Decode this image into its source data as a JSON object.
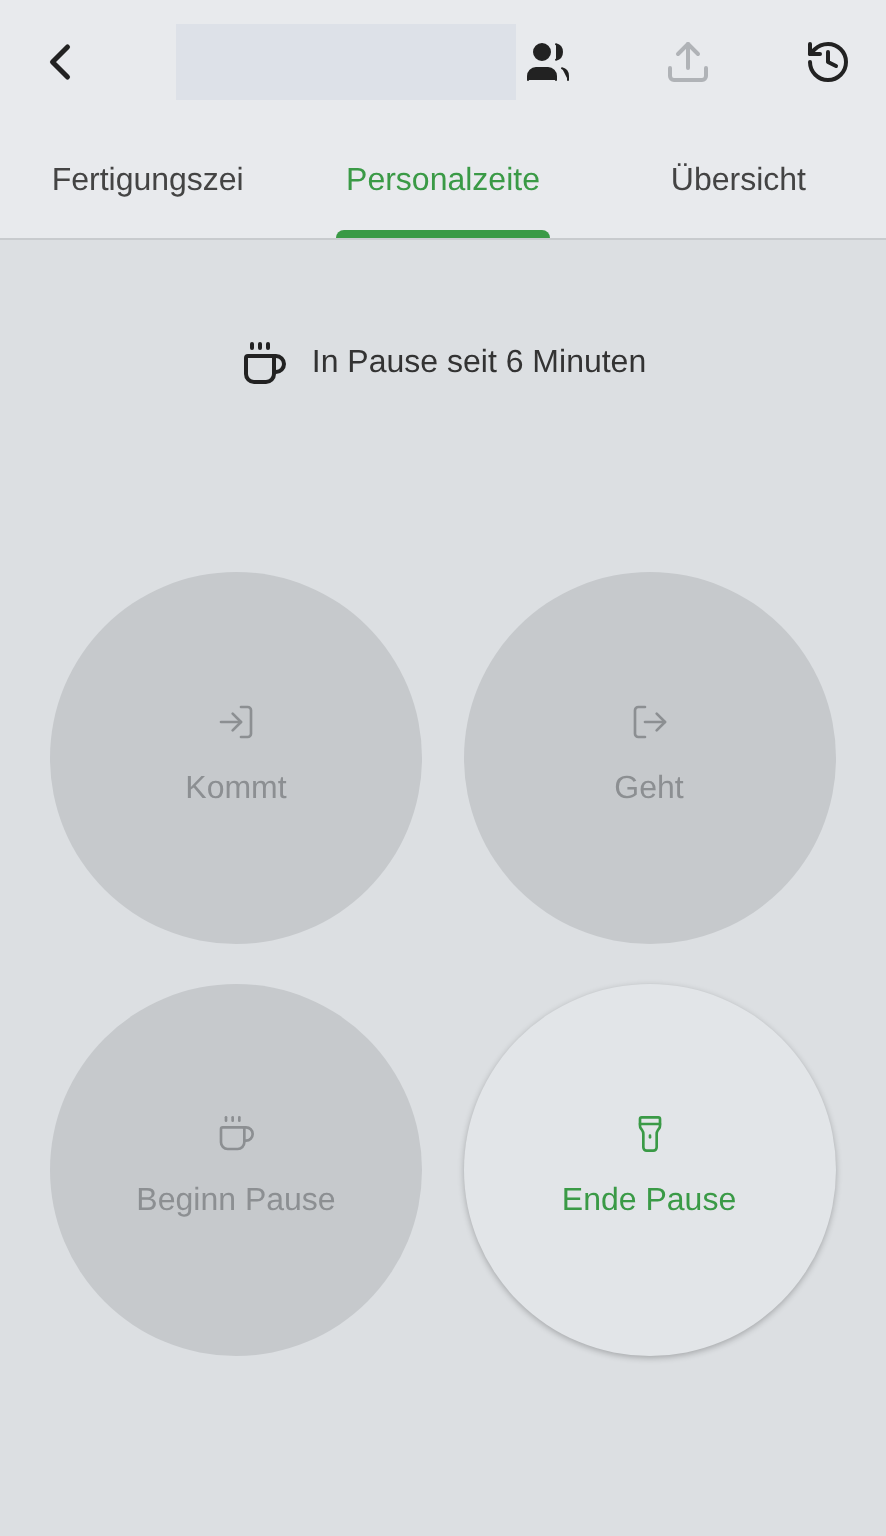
{
  "header": {
    "actions": [
      {
        "kind": "people",
        "disabled": false
      },
      {
        "kind": "upload",
        "disabled": true
      },
      {
        "kind": "history",
        "disabled": false
      }
    ]
  },
  "tabs": [
    {
      "label": "Fertigungszei",
      "selected": false
    },
    {
      "label": "Personalzeite",
      "selected": true
    },
    {
      "label": "Übersicht",
      "selected": false
    }
  ],
  "status": {
    "text": "In Pause seit 6 Minuten"
  },
  "buttons": [
    {
      "kind": "come",
      "label": "Kommt",
      "disabled": true
    },
    {
      "kind": "go",
      "label": "Geht",
      "disabled": true
    },
    {
      "kind": "break_start",
      "label": "Beginn Pause",
      "disabled": true
    },
    {
      "kind": "break_end",
      "label": "Ende Pause",
      "disabled": false
    }
  ]
}
